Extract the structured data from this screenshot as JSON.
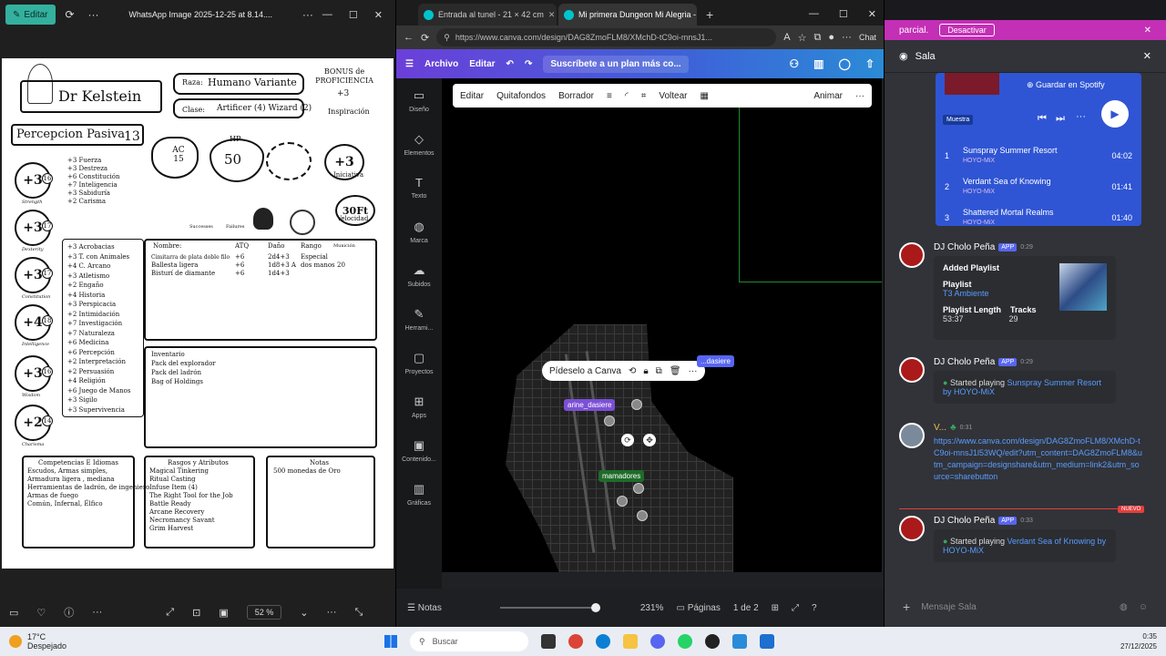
{
  "viewer": {
    "edit_label": "Editar",
    "title": "WhatsApp Image 2025-12-25 at 8.14....",
    "zoom": "52 %"
  },
  "sheet": {
    "name": "Dr Kelstein",
    "race_label": "Raza:",
    "race": "Humano Variante",
    "class_label": "Clase:",
    "class": "Artificer (4) Wizard (2)",
    "prof_label": "BONUS de PROFICIENCIA",
    "prof": "+3",
    "inspiration": "Inspiración",
    "passive": "Percepcion Pasiva",
    "passive_val": "13",
    "ac": "AC 15",
    "hp_label": "HP",
    "hp": "50",
    "initiative": "+3",
    "initiative_label": "Iniciativa",
    "speed": "30Ft",
    "speed_label": "Velocidad",
    "successes": "Successes",
    "failures": "Failures",
    "stats": [
      {
        "mod": "+3",
        "score": "16",
        "name": "Strength"
      },
      {
        "mod": "+3",
        "score": "17",
        "name": "Dexterity"
      },
      {
        "mod": "+3",
        "score": "17",
        "name": "Constitution"
      },
      {
        "mod": "+4",
        "score": "18",
        "name": "Intelligence"
      },
      {
        "mod": "+3",
        "score": "16",
        "name": "Wisdom"
      },
      {
        "mod": "+2",
        "score": "14",
        "name": "Charisma"
      }
    ],
    "saves": [
      "+3 Fuerza",
      "+3 Destreza",
      "+6 Constitución",
      "+7 Inteligencia",
      "+3 Sabiduría",
      "+2 Carisma"
    ],
    "skills": [
      "+3 Acrobacias",
      "+3 T. con Animales",
      "+4 C. Arcano",
      "+3 Atletismo",
      "+2 Engaño",
      "+4 Historia",
      "+3 Perspicacia",
      "+2 Intimidación",
      "+7 Investigación",
      "+7 Naturaleza",
      "+6 Medicina",
      "+6 Percepción",
      "+2 Interpretación",
      "+2 Persuasión",
      "+4 Religión",
      "+6 Juego de Manos",
      "+3 Sigilo",
      "+3 Supervivencia"
    ],
    "weapons_headers": [
      "Nombre:",
      "ATQ",
      "Daño",
      "Rango",
      "Munición"
    ],
    "weapons": [
      [
        "Cimitarra de plata doble filo",
        "+6",
        "2d4+3",
        "Especial",
        ""
      ],
      [
        "Ballesta ligera",
        "+6",
        "1d8+3 A",
        "dos manos",
        "20"
      ],
      [
        "Bisturí de diamante",
        "+6",
        "1d4+3",
        "",
        ""
      ]
    ],
    "inventory_title": "Inventario",
    "inventory": [
      "Pack del explorador",
      "Pack del ladrón",
      "Bag of Holdings"
    ],
    "prof_title": "Competencias E Idiomas",
    "prof_list": [
      "Escudos, Armas simples,",
      "Armadura ligera , mediana",
      "Herramientas de ladrón, de ingeniero",
      "Armas de fuego",
      "Común, Infernal, Élfico"
    ],
    "traits_title": "Rasgos y Atributos",
    "traits": [
      "Magical Tinkering",
      "Ritual Casting",
      "Infuse Item (4)",
      "The Right Tool for the Job",
      "Battle Ready",
      "Arcane Recovery",
      "Necromancy Savant",
      "Grim Harvest"
    ],
    "notes_title": "Notas",
    "notes": "500 monedas de Oro"
  },
  "browser": {
    "tabs": [
      "Entrada al tunel - 21 × 42 cm",
      "Mi primera Dungeon Mi Alegria -"
    ],
    "url": "https://www.canva.com/design/DAG8ZmoFLM8/XMchD-tC9oi-mnsJ1...",
    "chat": "Chat",
    "menu": "Archivo",
    "edit": "Editar",
    "subscribe": "Suscríbete a un plan más co...",
    "side": [
      "Diseño",
      "Elementos",
      "Texto",
      "Marca",
      "Subidos",
      "Herrami...",
      "Proyectos",
      "Apps",
      "Contenido...",
      "Gráficas"
    ],
    "toolbar": [
      "Editar",
      "Quitafondos",
      "Borrador",
      "Voltear",
      "Animar"
    ],
    "ask_canva": "Pídeselo a Canva",
    "labels": [
      "arine_dasiere",
      "mamadores",
      "...dasiere"
    ],
    "notes": "Notas",
    "zoom": "231%",
    "pages": "Páginas",
    "page_count": "1 de 2"
  },
  "discord": {
    "banner": "parcial.",
    "deactivate": "Desactivar",
    "channel": "Sala",
    "spotify_save": "Guardar en Spotify",
    "spotify_tag": "Muestra",
    "tracks": [
      {
        "n": "1",
        "title": "Sunspray Summer Resort",
        "artist": "HOYO-MiX",
        "time": "04:02"
      },
      {
        "n": "2",
        "title": "Verdant Sea of Knowing",
        "artist": "HOYO-MiX",
        "time": "01:41"
      },
      {
        "n": "3",
        "title": "Shattered Mortal Realms",
        "artist": "HOYO-MiX",
        "time": "01:40"
      }
    ],
    "bot_name": "DJ Cholo Peña",
    "app_tag": "APP",
    "m1_time": "0:29",
    "m1_added": "Added Playlist",
    "m1_playlist": "Playlist",
    "m1_pl_name": "T3 Ambiente",
    "m1_len_label": "Playlist Length",
    "m1_len": "53:37",
    "m1_tracks_label": "Tracks",
    "m1_tracks": "29",
    "m2_time": "0:29",
    "m2_text": "Started playing",
    "m2_song": "Sunspray Summer Resort by HOYO-MiX",
    "u3_name": "V...",
    "u3_time": "0:31",
    "u3_link": "https://www.canva.com/design/DAG8ZmoFLM8/XMchD-tC9oi-mnsJ1l53WQ/edit?utm_content=DAG8ZmoFLM8&utm_campaign=designshare&utm_medium=link2&utm_source=sharebutton",
    "nuevo": "NUEVO",
    "m4_time": "0:33",
    "m4_text": "Started playing",
    "m4_song": "Verdant Sea of Knowing by HOYO-MiX",
    "input": "Mensaje Sala"
  },
  "taskbar": {
    "temp": "17°C",
    "weather": "Despejado",
    "search": "Buscar",
    "time": "0:35",
    "date": "27/12/2025"
  }
}
